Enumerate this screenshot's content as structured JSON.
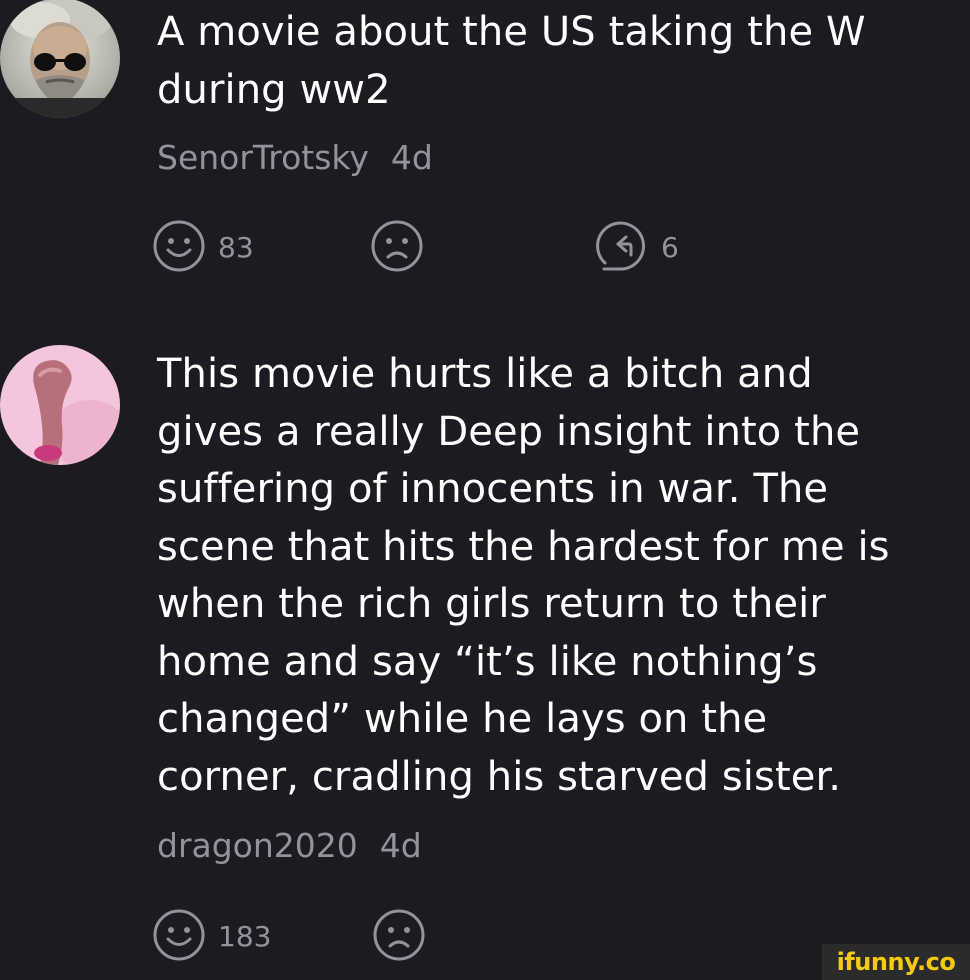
{
  "comments": [
    {
      "avatar": "trotsky-portrait-avatar",
      "text": "A movie about the US taking the W\nduring ww2",
      "username": "SenorTrotsky",
      "age": "4d",
      "upvotes": "83",
      "replies": "6"
    },
    {
      "avatar": "pink-toy-avatar",
      "text": "This movie hurts like a bitch and\ngives a really Deep insight into the\nsuffering of innocents in war. The\nscene that hits the hardest for me is\nwhen the rich girls return to their\nhome and say “it’s like nothing’s\nchanged” while he lays on the\ncorner, cradling his starved sister.",
      "username": "dragon2020",
      "age": "4d",
      "upvotes": "183"
    }
  ],
  "watermark": "ifunny.co",
  "colors": {
    "background": "#1c1b21",
    "text": "#ffffff",
    "meta": "#94939b",
    "watermark": "#f6c915"
  },
  "icons": [
    "smile-icon",
    "frown-icon",
    "reply-icon"
  ]
}
